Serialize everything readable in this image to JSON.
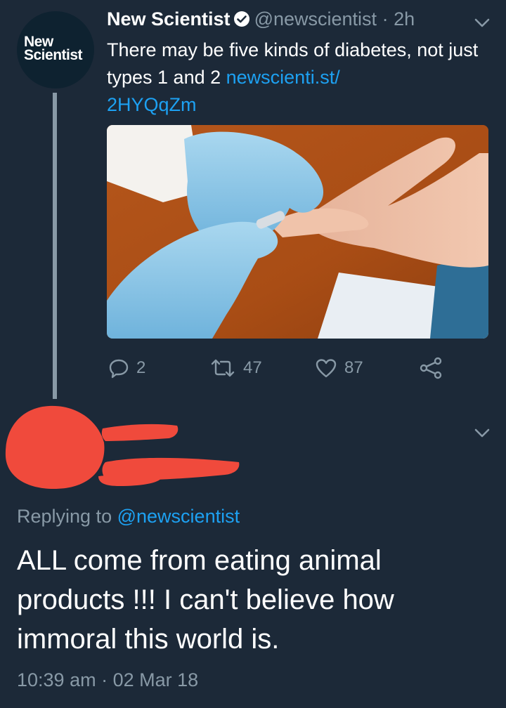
{
  "tweet": {
    "author_name": "New Scientist",
    "handle": "@newscientist",
    "time_separator": "·",
    "age": "2h",
    "avatar_logo_line1": "New",
    "avatar_logo_line2": "Scientist",
    "text": "There may be five kinds of diabetes, not just types 1 and 2",
    "link_line1": "newscienti.st/",
    "link_line2": "2HYQqZm",
    "media_description_icon": "photo",
    "actions": {
      "reply_count": "2",
      "retweet_count": "47",
      "like_count": "87"
    }
  },
  "reply": {
    "replying_prefix": "Replying to",
    "replying_handle": "@newscientist",
    "text": "ALL come from eating animal products !!! I can't believe how immoral this world is.",
    "timestamp": "10:39 am · 02 Mar 18"
  },
  "colors": {
    "background": "#1c2938",
    "secondary_text": "#8899a6",
    "link": "#1da1f2",
    "redaction": "#f04a3c"
  }
}
